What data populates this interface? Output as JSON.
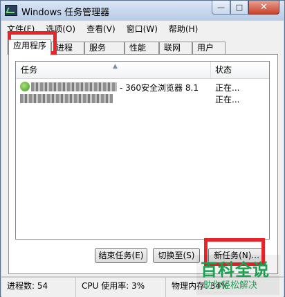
{
  "window": {
    "title": "Windows 任务管理器",
    "min_glyph": "—",
    "max_glyph": "□",
    "close_glyph": "✕"
  },
  "menu": [
    "文件(F)",
    "选项(O)",
    "查看(V)",
    "窗口(W)",
    "帮助(H)"
  ],
  "tabs": [
    "应用程序",
    "进程",
    "服务",
    "性能",
    "联网",
    "用户"
  ],
  "active_tab": "应用程序",
  "list": {
    "columns": {
      "task": "任务",
      "status": "状态"
    },
    "sort_glyph": "▲",
    "rows": [
      {
        "name": "- 360安全浏览器 8.1",
        "status": "正在..."
      },
      {
        "name": "",
        "status": "正在..."
      }
    ]
  },
  "buttons": {
    "end_task": "结束任务(E)",
    "switch_to": "切换至(S)",
    "new_task": "新任务(N)..."
  },
  "statusbar": {
    "processes": "进程数: 54",
    "cpu": "CPU 使用率: 3%",
    "memory": "物理内存: 34%"
  },
  "watermark": {
    "title": "百科全说",
    "subtitle": "助你轻松解决"
  },
  "colors": {
    "highlight": "#e8242a",
    "watermark": "#1aa04e"
  }
}
